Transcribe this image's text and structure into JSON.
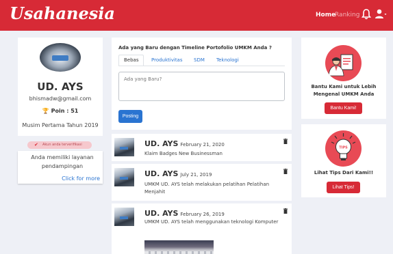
{
  "navbar": {
    "brand": "Usahanesia",
    "home": "Home",
    "ranking": "Ranking"
  },
  "profile": {
    "name": "UD. AYS",
    "email": "bhismadw@gmail.com",
    "poin": "Poin : 51",
    "season": "Musim Pertama Tahun 2019",
    "verified_badge": "Akun anda terverifikasi",
    "service_text": "Anda memiliki layanan pendampingan",
    "service_link": "Click for more"
  },
  "post_form": {
    "title": "Ada yang Baru dengan Timeline Portofolio UMKM Anda ?",
    "tabs": [
      "Bebas",
      "Produktivitas",
      "SDM",
      "Teknologi"
    ],
    "placeholder": "Ada yang Baru?",
    "submit": "Posting"
  },
  "feed": [
    {
      "name": "UD. AYS",
      "date": "February 21, 2020",
      "text": "Klaim Badges New Businessman"
    },
    {
      "name": "UD. AYS",
      "date": "July 21, 2019",
      "text": "UMKM UD. AYS telah melakukan pelatihan Pelatihan Menjahit"
    },
    {
      "name": "UD. AYS",
      "date": "February 26, 2019",
      "text": "UMKM UD. AYS telah menggunakan teknologi Komputer"
    }
  ],
  "sidebar_right": {
    "survey_text": "Bantu Kami untuk Lebih Mengenal UMKM Anda",
    "survey_button": "Bantu Kami!",
    "tips_text": "Lihat Tips Dari Kami!!",
    "tips_button": "Lihat Tips!",
    "tips_label": "TIPS"
  },
  "colors": {
    "brand_red": "#d72a36",
    "link_blue": "#2a74d1",
    "background": "#eef0f6"
  },
  "icons": {
    "bell": "bell-icon",
    "user": "user-icon",
    "trophy": "trophy-icon",
    "check": "check-icon",
    "trash": "trash-icon"
  }
}
